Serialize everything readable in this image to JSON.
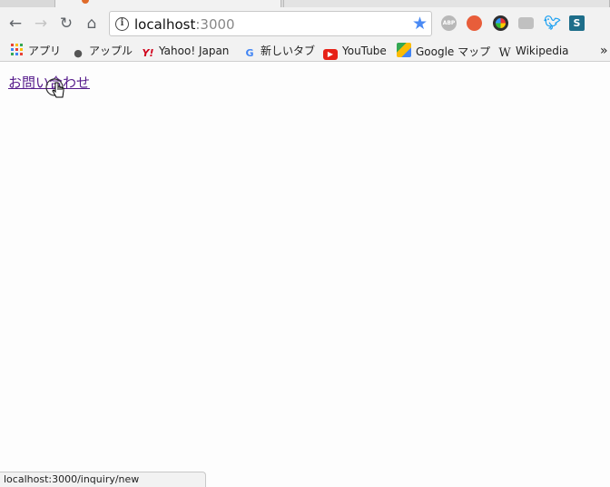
{
  "browser": {
    "url_host": "localhost",
    "url_port": ":3000",
    "nav": {
      "back_glyph": "←",
      "forward_glyph": "→",
      "reload_glyph": "↻",
      "home_glyph": "⌂"
    },
    "star_glyph": "★",
    "extensions": [
      {
        "icon": "adblock-plus-icon",
        "label": "ABP",
        "color": "#b8b8b8"
      },
      {
        "icon": "cookie-extension-icon",
        "label": "",
        "color": "#e85d3a"
      },
      {
        "icon": "color-wheel-icon",
        "label": "",
        "color": "#2f2f2f"
      },
      {
        "icon": "camera-icon",
        "label": "",
        "color": "#c0c0c0"
      },
      {
        "icon": "twitter-bird-icon",
        "label": "",
        "color": "#1da1f2"
      },
      {
        "icon": "s-extension-icon",
        "label": "S",
        "color": "#1e6e8a"
      }
    ]
  },
  "bookmarks": [
    {
      "label": "アプリ",
      "icon": "apps-grid-icon"
    },
    {
      "label": "アップル",
      "icon": "apple-icon"
    },
    {
      "label": "Yahoo! Japan",
      "icon": "yahoo-icon"
    },
    {
      "label": "新しいタブ",
      "icon": "google-g-icon"
    },
    {
      "label": "YouTube",
      "icon": "youtube-icon"
    },
    {
      "label": "Google マップ",
      "icon": "google-maps-icon"
    },
    {
      "label": "Wikipedia",
      "icon": "wikipedia-icon"
    }
  ],
  "bookmarks_overflow": "»",
  "page": {
    "link_text": "お問い合わせ"
  },
  "status": {
    "hover_url": "localhost:3000/inquiry/new"
  },
  "colors": {
    "link_visited": "#551a8b",
    "star": "#4a8af4"
  }
}
